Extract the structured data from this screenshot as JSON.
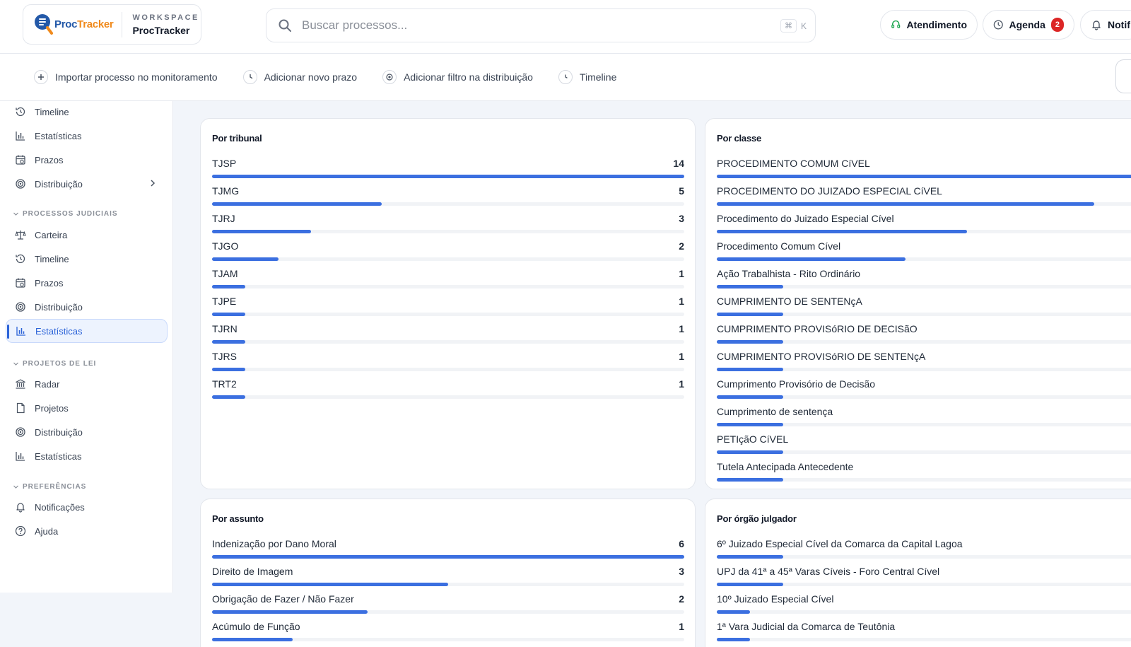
{
  "header": {
    "logo": {
      "part1": "Proc",
      "part2": "Tracker"
    },
    "workspace_label": "WORKSPACE",
    "workspace_name": "ProcTracker",
    "search": {
      "placeholder": "Buscar processos...",
      "shortcut_key1": "⌘",
      "shortcut_key2": "K"
    },
    "buttons": {
      "atendimento": "Atendimento",
      "agenda": "Agenda",
      "agenda_badge": "2",
      "notificacoes": "Notif"
    }
  },
  "actions": [
    {
      "label": "Importar processo no monitoramento",
      "icon": "plus-circle-icon"
    },
    {
      "label": "Adicionar novo prazo",
      "icon": "clock-icon"
    },
    {
      "label": "Adicionar filtro na distribuição",
      "icon": "target-icon"
    },
    {
      "label": "Timeline",
      "icon": "history-icon"
    }
  ],
  "sidebar": {
    "top_items": [
      {
        "label": "Timeline",
        "icon": "history-icon"
      },
      {
        "label": "Estatísticas",
        "icon": "bar-chart-icon"
      },
      {
        "label": "Prazos",
        "icon": "calendar-clock-icon"
      },
      {
        "label": "Distribuição",
        "icon": "target-icon"
      }
    ],
    "sections": [
      {
        "title": "PROCESSOS JUDICIAIS",
        "items": [
          {
            "label": "Carteira",
            "icon": "scale-icon"
          },
          {
            "label": "Timeline",
            "icon": "history-icon"
          },
          {
            "label": "Prazos",
            "icon": "calendar-clock-icon"
          },
          {
            "label": "Distribuição",
            "icon": "target-icon"
          },
          {
            "label": "Estatísticas",
            "icon": "bar-chart-icon",
            "active": true
          }
        ]
      },
      {
        "title": "PROJETOS DE LEI",
        "items": [
          {
            "label": "Radar",
            "icon": "bank-icon"
          },
          {
            "label": "Projetos",
            "icon": "document-icon"
          },
          {
            "label": "Distribuição",
            "icon": "target-icon"
          },
          {
            "label": "Estatísticas",
            "icon": "bar-chart-icon"
          }
        ]
      },
      {
        "title": "PREFERÊNCIAS",
        "items": [
          {
            "label": "Notificações",
            "icon": "bell-icon"
          },
          {
            "label": "Ajuda",
            "icon": "help-circle-icon"
          }
        ]
      }
    ]
  },
  "colors": {
    "accent": "#3b6fe0",
    "badge": "#dc2626"
  },
  "cards": {
    "tribunal": {
      "title": "Por tribunal",
      "rows": [
        {
          "label": "TJSP",
          "value": 14,
          "fraction": 1.0
        },
        {
          "label": "TJMG",
          "value": 5,
          "fraction": 0.36
        },
        {
          "label": "TJRJ",
          "value": 3,
          "fraction": 0.21
        },
        {
          "label": "TJGO",
          "value": 2,
          "fraction": 0.14
        },
        {
          "label": "TJAM",
          "value": 1,
          "fraction": 0.07
        },
        {
          "label": "TJPE",
          "value": 1,
          "fraction": 0.07
        },
        {
          "label": "TJRN",
          "value": 1,
          "fraction": 0.07
        },
        {
          "label": "TJRS",
          "value": 1,
          "fraction": 0.07
        },
        {
          "label": "TRT2",
          "value": 1,
          "fraction": 0.07
        }
      ]
    },
    "classe": {
      "title": "Por classe",
      "rows": [
        {
          "label": "PROCEDIMENTO COMUM CíVEL",
          "fraction": 1.0
        },
        {
          "label": "PROCEDIMENTO DO JUIZADO ESPECIAL CíVEL",
          "fraction": 0.8
        },
        {
          "label": "Procedimento do Juizado Especial Cível",
          "fraction": 0.53
        },
        {
          "label": "Procedimento Comum Cível",
          "fraction": 0.4
        },
        {
          "label": "Ação Trabalhista - Rito Ordinário",
          "fraction": 0.14
        },
        {
          "label": "CUMPRIMENTO DE SENTENçA",
          "fraction": 0.14
        },
        {
          "label": "CUMPRIMENTO PROVISóRIO DE DECISãO",
          "fraction": 0.14
        },
        {
          "label": "CUMPRIMENTO PROVISóRIO DE SENTENçA",
          "fraction": 0.14
        },
        {
          "label": "Cumprimento Provisório de Decisão",
          "fraction": 0.14
        },
        {
          "label": "Cumprimento de sentença",
          "fraction": 0.14
        },
        {
          "label": "PETIçãO CíVEL",
          "fraction": 0.14
        },
        {
          "label": "Tutela Antecipada Antecedente",
          "fraction": 0.14
        }
      ]
    },
    "assunto": {
      "title": "Por assunto",
      "rows": [
        {
          "label": "Indenização por Dano Moral",
          "value": 6,
          "fraction": 1.0
        },
        {
          "label": "Direito de Imagem",
          "value": 3,
          "fraction": 0.5
        },
        {
          "label": "Obrigação de Fazer / Não Fazer",
          "value": 2,
          "fraction": 0.33
        },
        {
          "label": "Acúmulo de Função",
          "value": 1,
          "fraction": 0.17
        }
      ]
    },
    "orgao": {
      "title": "Por órgão julgador",
      "rows": [
        {
          "label": "6º Juizado Especial Cível da Comarca da Capital Lagoa",
          "fraction": 0.14
        },
        {
          "label": "UPJ da 41ª a 45ª Varas Cíveis - Foro Central Cível",
          "fraction": 0.14
        },
        {
          "label": "10º Juizado Especial Cível",
          "fraction": 0.07
        },
        {
          "label": "1ª Vara Judicial da Comarca de Teutônia",
          "fraction": 0.07
        }
      ]
    }
  }
}
